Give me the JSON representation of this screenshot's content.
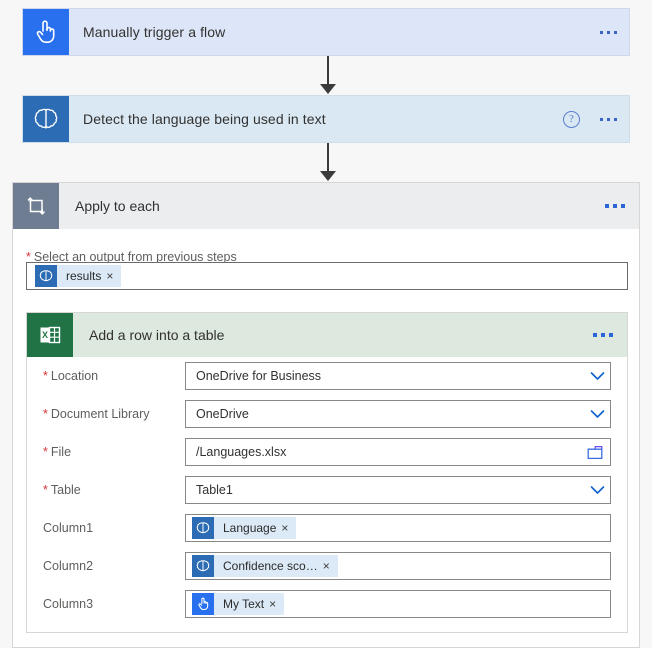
{
  "flow": {
    "trigger": {
      "title": "Manually trigger a flow",
      "icon": "hand-pointer-icon",
      "icon_bg": "#2870ED",
      "body_bg": "#DDE6F8",
      "menu": "more-options"
    },
    "detect": {
      "title": "Detect the language being used in text",
      "icon": "brain-icon",
      "icon_bg": "#2B6CB5",
      "body_bg": "#D9E8F2",
      "help": "?",
      "menu": "more-options"
    },
    "apply_to_each": {
      "title": "Apply to each",
      "icon": "loop-icon",
      "icon_bg": "#6E7D91",
      "header_bg": "#EBEDEF",
      "menu": "more-options",
      "select_output": {
        "label": "Select an output from previous steps",
        "required": true,
        "token": {
          "text": "results",
          "icon": "brain-icon",
          "remove": "×"
        }
      }
    },
    "excel_action": {
      "title": "Add a row into a table",
      "icon": "excel-icon",
      "icon_bg": "#217346",
      "header_bg": "#DDE8DE",
      "menu": "more-options",
      "fields": [
        {
          "label": "Location",
          "required": true,
          "type": "dropdown",
          "value": "OneDrive for Business",
          "trailing_icon": "chevron-down-icon"
        },
        {
          "label": "Document Library",
          "required": true,
          "type": "dropdown",
          "value": "OneDrive",
          "trailing_icon": "chevron-down-icon"
        },
        {
          "label": "File",
          "required": true,
          "type": "file-picker",
          "value": "/Languages.xlsx",
          "trailing_icon": "folder-icon"
        },
        {
          "label": "Table",
          "required": true,
          "type": "dropdown",
          "value": "Table1",
          "trailing_icon": "chevron-down-icon"
        },
        {
          "label": "Column1",
          "required": false,
          "type": "token",
          "token": {
            "text": "Language",
            "icon": "brain-icon",
            "remove": "×"
          }
        },
        {
          "label": "Column2",
          "required": false,
          "type": "token",
          "token": {
            "text": "Confidence sco…",
            "icon": "brain-icon",
            "remove": "×"
          }
        },
        {
          "label": "Column3",
          "required": false,
          "type": "token",
          "token": {
            "text": "My Text",
            "icon": "hand-pointer-icon",
            "remove": "×"
          }
        }
      ]
    }
  }
}
